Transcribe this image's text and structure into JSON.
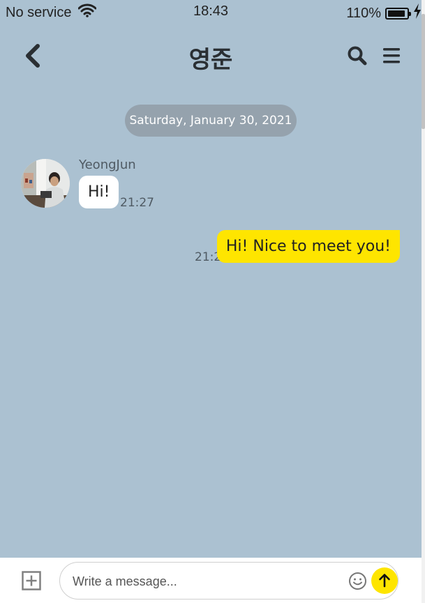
{
  "status_bar": {
    "carrier": "No service",
    "time": "18:43",
    "battery": "110%",
    "wifi_icon": "wifi-icon",
    "battery_icon": "battery-icon",
    "charging_icon": "lightning-icon"
  },
  "header": {
    "title": "영준",
    "back_icon": "chevron-left-icon",
    "search_icon": "search-icon",
    "menu_icon": "hamburger-menu-icon"
  },
  "chat": {
    "date_divider": "Saturday, January 30, 2021",
    "messages": [
      {
        "direction": "incoming",
        "sender": "YeongJun",
        "text": "Hi!",
        "time": "21:27"
      },
      {
        "direction": "outgoing",
        "text": "Hi! Nice to meet you!",
        "time": "21:27"
      }
    ]
  },
  "input_bar": {
    "placeholder": "Write a message...",
    "value": "",
    "add_icon": "plus-square-icon",
    "emoji_icon": "smiley-icon",
    "send_icon": "arrow-up-icon"
  },
  "colors": {
    "background": "#abc1d1",
    "outgoing_bubble": "#fee500",
    "incoming_bubble": "#ffffff",
    "date_chip": "#95a2ad",
    "send_button": "#fee500"
  }
}
